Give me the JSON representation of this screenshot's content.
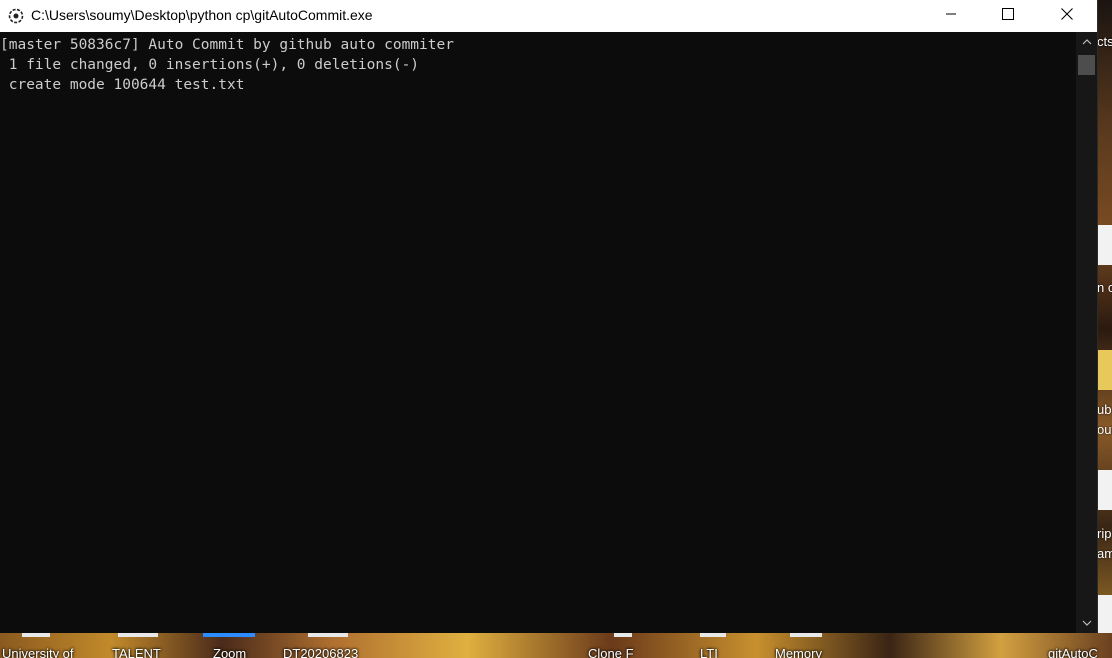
{
  "window": {
    "title": "C:\\Users\\soumy\\Desktop\\python cp\\gitAutoCommit.exe",
    "app_icon": "console-app-icon",
    "controls": {
      "minimize": "minimize-icon",
      "maximize": "maximize-icon",
      "close": "close-icon"
    }
  },
  "console": {
    "lines": [
      "[master 50836c7] Auto Commit by github auto commiter",
      " 1 file changed, 0 insertions(+), 0 deletions(-)",
      " create mode 100644 test.txt"
    ],
    "background_color": "#0c0c0c",
    "text_color": "#cccccc"
  },
  "scrollbar": {
    "up_icon": "chevron-up-icon",
    "down_icon": "chevron-down-icon"
  },
  "desktop": {
    "right_fragments": [
      "cts",
      "n c",
      "ub",
      "out",
      "rip",
      "am"
    ],
    "bottom_labels": [
      "University of",
      "TALENT",
      "Zoom",
      "DT20206823",
      "Clone F",
      "LTI",
      "Memory",
      "gitAutoC"
    ]
  }
}
